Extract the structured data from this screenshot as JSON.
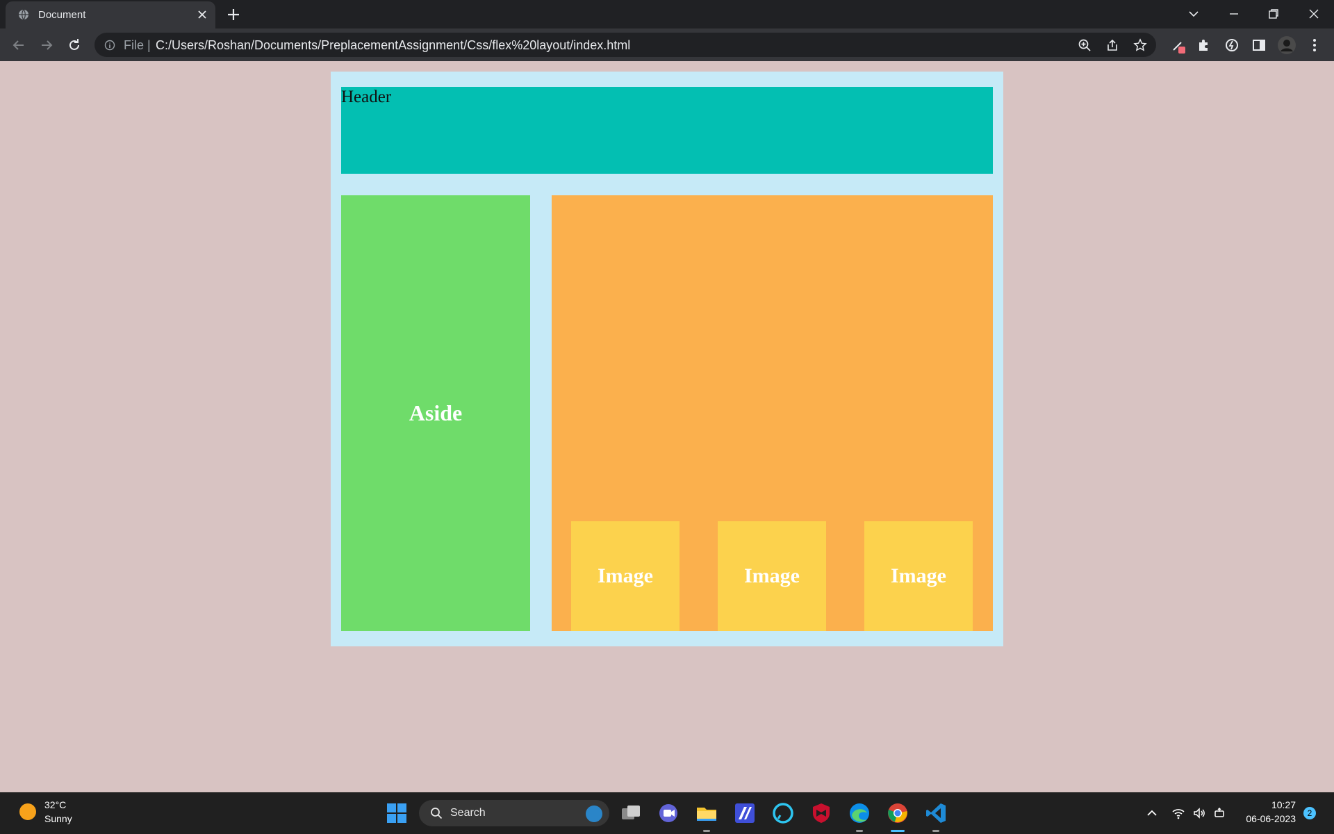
{
  "browser": {
    "tab": {
      "title": "Document"
    },
    "address": {
      "scheme_label": "File",
      "url": "C:/Users/Roshan/Documents/PreplacementAssignment/Css/flex%20layout/index.html"
    }
  },
  "page": {
    "header_text": "Header",
    "aside_text": "Aside",
    "images": [
      {
        "label": "Image"
      },
      {
        "label": "Image"
      },
      {
        "label": "Image"
      }
    ]
  },
  "taskbar": {
    "weather": {
      "temp": "32°C",
      "condition": "Sunny"
    },
    "search_label": "Search",
    "clock": {
      "time": "10:27",
      "date": "06-06-2023"
    },
    "notification_count": "2"
  }
}
